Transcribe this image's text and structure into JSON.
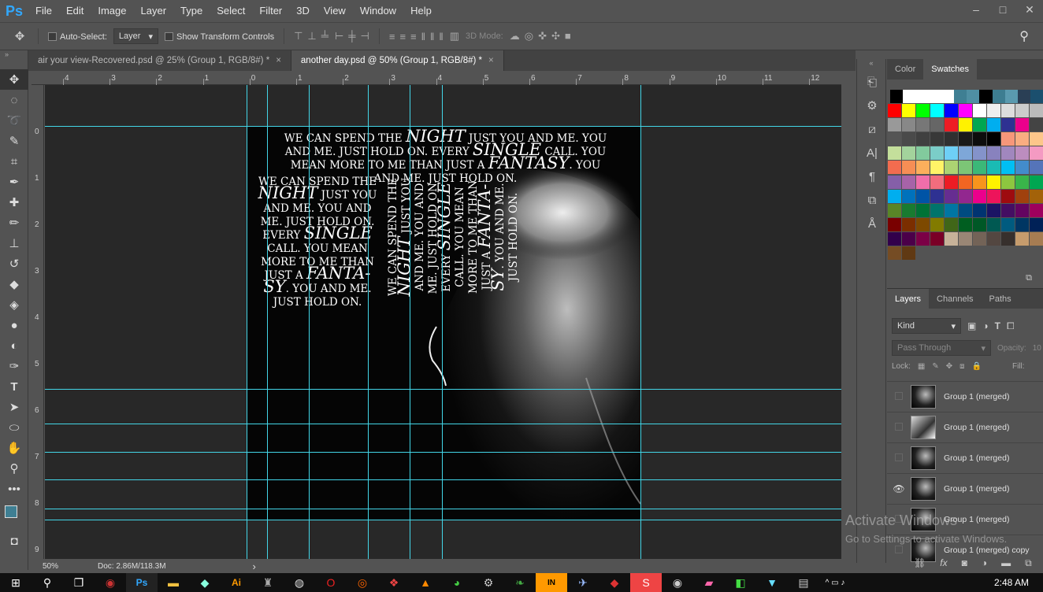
{
  "app": {
    "logo": "Ps"
  },
  "menu": [
    "File",
    "Edit",
    "Image",
    "Layer",
    "Type",
    "Select",
    "Filter",
    "3D",
    "View",
    "Window",
    "Help"
  ],
  "window_controls": [
    "–",
    "□",
    "✕"
  ],
  "options": {
    "auto_select_label": "Auto-Select:",
    "auto_select_value": "Layer",
    "show_transform_label": "Show Transform Controls",
    "mode_3d_label": "3D Mode:"
  },
  "tabs": [
    {
      "label": "air your view-Recovered.psd @ 25% (Group 1, RGB/8#) *",
      "close": "×",
      "active": false
    },
    {
      "label": "another day.psd @ 50% (Group 1, RGB/8#) *",
      "close": "×",
      "active": true
    }
  ],
  "ruler_top": [
    "4",
    "3",
    "2",
    "1",
    "0",
    "1",
    "2",
    "3",
    "4",
    "5",
    "6",
    "7",
    "8",
    "9",
    "10",
    "11",
    "12"
  ],
  "ruler_left": [
    "0",
    "1",
    "2",
    "3",
    "4",
    "5",
    "6",
    "7",
    "8",
    "9"
  ],
  "artwork_text": {
    "horizontal_lines": [
      {
        "pre": "WE CAN SPEND THE ",
        "em": "NIGHT",
        "post": " JUST YOU AND ME. YOU"
      },
      {
        "pre": "AND ME. JUST HOLD ON. EVERY ",
        "em": "SINGLE",
        "post": " CALL. YOU"
      },
      {
        "pre": "MEAN MORE TO ME THAN JUST A ",
        "em": "FANTASY",
        "post": ". YOU"
      },
      {
        "pre": "AND ME. JUST HOLD ON.",
        "em": "",
        "post": ""
      }
    ],
    "column_lines": [
      {
        "pre": "WE CAN SPEND THE",
        "em": "",
        "post": ""
      },
      {
        "pre": "",
        "em": "NIGHT",
        "post": " JUST YOU"
      },
      {
        "pre": "AND ME. YOU AND",
        "em": "",
        "post": ""
      },
      {
        "pre": "ME. JUST HOLD ON.",
        "em": "",
        "post": ""
      },
      {
        "pre": "EVERY ",
        "em": "SINGLE",
        "post": ""
      },
      {
        "pre": "CALL. YOU MEAN",
        "em": "",
        "post": ""
      },
      {
        "pre": "MORE TO ME THAN",
        "em": "",
        "post": ""
      },
      {
        "pre": "JUST A ",
        "em": "FANTA-",
        "post": ""
      },
      {
        "pre": "",
        "em": "SY",
        "post": ". YOU AND ME."
      },
      {
        "pre": "JUST HOLD ON.",
        "em": "",
        "post": ""
      }
    ],
    "vertical_lines": [
      {
        "pre": "WE CAN SPEND THE",
        "em": "",
        "post": ""
      },
      {
        "pre": "",
        "em": "NIGHT",
        "post": " JUST YOU"
      },
      {
        "pre": "AND ME. YOU AND",
        "em": "",
        "post": ""
      },
      {
        "pre": "ME. JUST HOLD ON.",
        "em": "",
        "post": ""
      },
      {
        "pre": "EVERY ",
        "em": "SINGLE",
        "post": ""
      },
      {
        "pre": "CALL. YOU MEAN",
        "em": "",
        "post": ""
      },
      {
        "pre": "MORE TO ME THAN",
        "em": "",
        "post": ""
      },
      {
        "pre": "JUST A ",
        "em": "FANTA-",
        "post": ""
      },
      {
        "pre": "",
        "em": "SY",
        "post": ". YOU AND ME."
      },
      {
        "pre": "JUST HOLD ON.",
        "em": "",
        "post": ""
      }
    ]
  },
  "status": {
    "zoom": "50%",
    "doc": "Doc: 2.86M/118.3M",
    "arrow": "›"
  },
  "panel_tabs_top": [
    "Color",
    "Swatches"
  ],
  "swatch_colors": [
    [
      "#000000",
      "#ffffff",
      "#ffffff",
      "#ffffff",
      "#ffffff",
      "#3f7f93",
      "#4f8fa3",
      "#000000",
      "#3d7d91",
      "#5a9aaf",
      "#2a3f55",
      "#1b4f6e",
      "#000000"
    ],
    [
      "#ff0000",
      "#ffff00",
      "#00ff00",
      "#00ffff",
      "#0000ff",
      "#ff00ff",
      "#ffffff",
      "#eeeeee",
      "#dddddd",
      "#cccccc",
      "#bbbbbb",
      "#aaaaaa"
    ],
    [
      "#999999",
      "#888888",
      "#777777",
      "#666666",
      "#ee1c24",
      "#fff200",
      "#00a651",
      "#00aeef",
      "#2e3192",
      "#ec008c",
      "#444444",
      "#333333"
    ],
    [
      "#555555",
      "#4a4a4a",
      "#404040",
      "#383838",
      "#303030",
      "#1a1a1a",
      "#0d0d0d",
      "#000000",
      "#f7977a",
      "#f9ad81",
      "#fdc68a",
      "#fff79a"
    ],
    [
      "#c4df9b",
      "#a3d39c",
      "#82ca9d",
      "#7bcdc8",
      "#6ecff6",
      "#7ea7d8",
      "#8493ca",
      "#8882be",
      "#a187be",
      "#bc8dbf",
      "#f49ac2",
      "#f6989d"
    ],
    [
      "#f26c4f",
      "#f68e55",
      "#fbaf5c",
      "#fff467",
      "#acd372",
      "#7cc576",
      "#3bb878",
      "#1abbb4",
      "#00bff3",
      "#438ccb",
      "#5574b9",
      "#605ca8"
    ],
    [
      "#855fa8",
      "#a763a8",
      "#f06eaa",
      "#f26d7d",
      "#ed1c24",
      "#f26522",
      "#f7941d",
      "#fff200",
      "#8dc63f",
      "#39b54a",
      "#00a651",
      "#00a99d"
    ],
    [
      "#00aeef",
      "#0072bc",
      "#0054a6",
      "#2e3192",
      "#662d91",
      "#92278f",
      "#ec008c",
      "#ed145b",
      "#9e0b0f",
      "#a0410d",
      "#a36209",
      "#aba000"
    ],
    [
      "#598527",
      "#197b30",
      "#007236",
      "#00746b",
      "#0076a3",
      "#004b80",
      "#003471",
      "#1b1464",
      "#440e62",
      "#630460",
      "#9e005d",
      "#9e0039"
    ],
    [
      "#790000",
      "#7b2e00",
      "#7d4900",
      "#827b00",
      "#406618",
      "#005e20",
      "#005826",
      "#005952",
      "#005b7f",
      "#003663",
      "#002157",
      "#0d004c"
    ],
    [
      "#32004b",
      "#4b0049",
      "#7b0046",
      "#7a0026",
      "#c7b299",
      "#998675",
      "#736357",
      "#534741",
      "#37302d",
      "#c69c6d",
      "#a67c52",
      "#8c6239"
    ],
    [
      "#754c24",
      "#603913"
    ]
  ],
  "layers": {
    "tabs": [
      "Layers",
      "Channels",
      "Paths"
    ],
    "kind": "Kind",
    "blend": "Pass Through",
    "opacity_label": "Opacity:",
    "opacity_value": "10",
    "lock_label": "Lock:",
    "fill_label": "Fill:",
    "items": [
      {
        "name": "Group 1 (merged)",
        "visible": false
      },
      {
        "name": "Group 1 (merged)",
        "visible": false
      },
      {
        "name": "Group 1 (merged)",
        "visible": false
      },
      {
        "name": "Group 1 (merged)",
        "visible": true
      },
      {
        "name": "Group 1 (merged)",
        "visible": false
      },
      {
        "name": "Group 1 (merged) copy",
        "visible": false
      }
    ]
  },
  "watermark": {
    "title": "Activate Windows",
    "sub": "Go to Settings to activate Windows."
  },
  "clock": {
    "time": "2:48 AM"
  }
}
